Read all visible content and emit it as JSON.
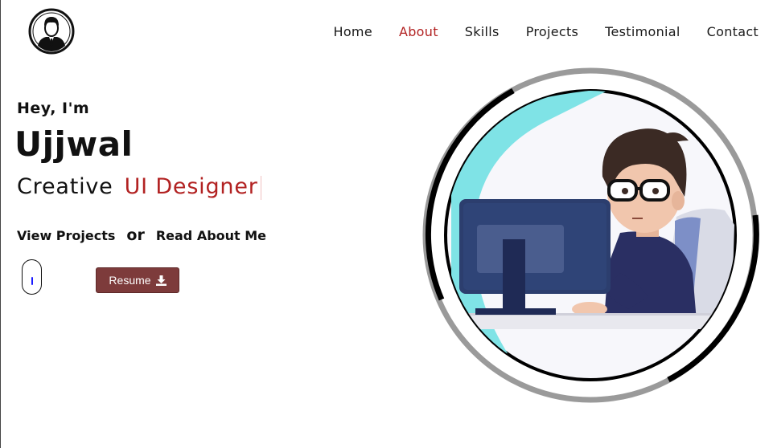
{
  "header": {
    "logo_icon": "user-avatar-icon",
    "nav": [
      {
        "label": "Home",
        "active": false
      },
      {
        "label": "About",
        "active": true
      },
      {
        "label": "Skills",
        "active": false
      },
      {
        "label": "Projects",
        "active": false
      },
      {
        "label": "Testimonial",
        "active": false
      },
      {
        "label": "Contact",
        "active": false
      }
    ]
  },
  "hero": {
    "greeting": "Hey, I'm",
    "name": "Ujjwal",
    "role_prefix": "Creative",
    "role_typed": "UI Designer",
    "link_projects": "View Projects",
    "or_text": "or",
    "link_about": "Read About Me",
    "scroll_icon": "mouse-scroll-icon",
    "resume_label": "Resume",
    "resume_icon": "download-icon"
  },
  "illustration": {
    "icon": "developer-at-computer-illustration"
  },
  "colors": {
    "accent": "#b22222",
    "button_bg": "#7d3b3b",
    "text": "#111111"
  }
}
